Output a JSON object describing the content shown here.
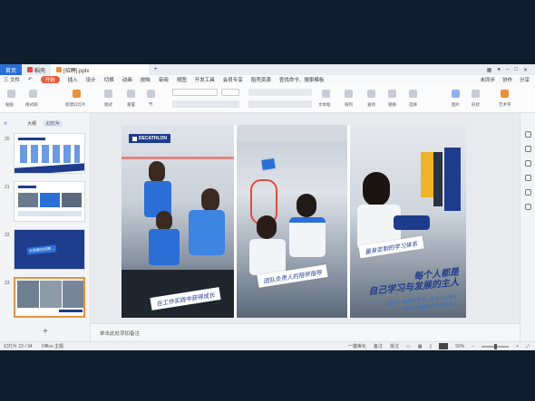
{
  "titlebar": {
    "home_tab": "首页",
    "tabs": [
      {
        "label": "稻壳",
        "color": "#e34b3b"
      },
      {
        "label": "[招聘].pptx",
        "color": "#e8913c"
      }
    ],
    "add_tab": "+"
  },
  "menubar": {
    "file": "三 文件",
    "items": [
      "开始",
      "插入",
      "设计",
      "切换",
      "动画",
      "放映",
      "审阅",
      "视图",
      "开发工具",
      "会员专享",
      "稻壳资源"
    ],
    "search": "查找命令、搜索模板",
    "right": [
      "未同步",
      "协作",
      "分享"
    ]
  },
  "ribbon": {
    "labels": [
      "粘贴",
      "格式刷",
      "新建幻灯片",
      "版式",
      "重置",
      "节",
      "文本框",
      "排列",
      "查找",
      "替换",
      "选择",
      "图片",
      "形状",
      "艺术字"
    ]
  },
  "leftpanel": {
    "tabs": [
      "大纲",
      "幻灯片"
    ],
    "selected_tab": "幻灯片",
    "slide_numbers": [
      "20",
      "21",
      "22",
      "23"
    ],
    "thumb3_text": "大家都在招聘 ...",
    "add": "+"
  },
  "slide": {
    "brand": "DECATHLON",
    "captions": [
      "在工作实践中获得成长",
      "团队负责人的陪伴指导",
      "量身定制的学习体系"
    ],
    "slogan": [
      "每个人都是",
      "自己学习与发展的主人"
    ],
    "small": [
      "让我们一起共同学习，助力人人成长",
      "每个人都是自己学习的主人"
    ]
  },
  "notes": {
    "placeholder": "单击此处添加备注"
  },
  "statusbar": {
    "slide_info": "幻灯片 23 / 34",
    "theme": "Office 主题",
    "beautify": "一键美化",
    "notes": "备注",
    "comment": "批注",
    "zoom": "50%",
    "zoom_level": 0.5
  },
  "colors": {
    "accent": "#2b6fd6",
    "brand_blue": "#1e3c8c",
    "start_tab": "#e85d3c"
  }
}
